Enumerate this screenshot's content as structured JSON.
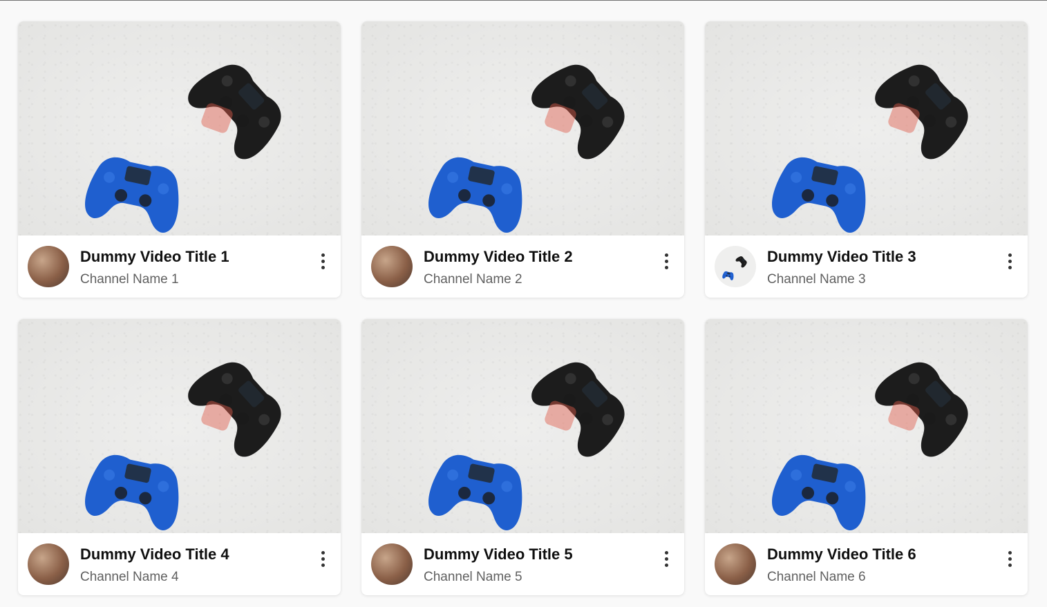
{
  "videos": [
    {
      "title": "Dummy Video Title 1",
      "channel": "Channel Name 1",
      "avatar_icon": "channel-avatar-photo"
    },
    {
      "title": "Dummy Video Title 2",
      "channel": "Channel Name 2",
      "avatar_icon": "channel-avatar-photo"
    },
    {
      "title": "Dummy Video Title 3",
      "channel": "Channel Name 3",
      "avatar_icon": "channel-avatar-controllers"
    },
    {
      "title": "Dummy Video Title 4",
      "channel": "Channel Name 4",
      "avatar_icon": "channel-avatar-photo"
    },
    {
      "title": "Dummy Video Title 5",
      "channel": "Channel Name 5",
      "avatar_icon": "channel-avatar-photo"
    },
    {
      "title": "Dummy Video Title 6",
      "channel": "Channel Name 6",
      "avatar_icon": "channel-avatar-photo"
    }
  ],
  "thumbnail_icon": "game-controllers-thumbnail",
  "menu_icon": "more-vertical-icon",
  "colors": {
    "blue_controller": "#1f5fcf",
    "black_controller": "#1c1c1c",
    "thumbnail_bg": "#e9e9e7",
    "title": "#0f0f0f",
    "channel": "#606060"
  }
}
